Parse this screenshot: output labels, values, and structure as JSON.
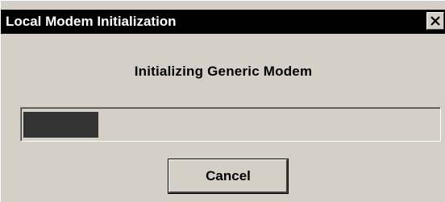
{
  "window": {
    "title": "Local Modem Initialization",
    "close_label": "X"
  },
  "dialog": {
    "message": "Initializing Generic Modem",
    "cancel_label": "Cancel"
  },
  "progress": {
    "fraction": 0.18
  },
  "colors": {
    "titlebar": "#000000",
    "title_text": "#ffffff",
    "face": "#d4d0c8",
    "progress_fill": "#333333"
  },
  "icons": {
    "close": "close-icon"
  }
}
